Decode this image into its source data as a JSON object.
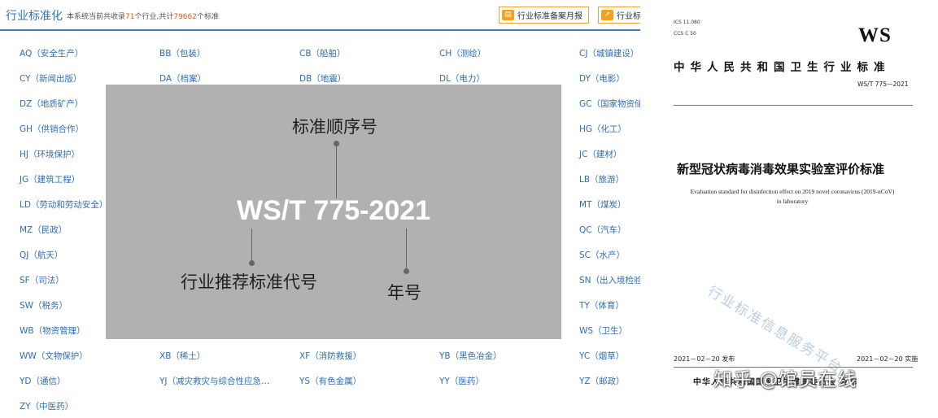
{
  "header": {
    "title": "行业标准化",
    "subtitle_prefix": "本系统当前共收录",
    "industry_count": "71",
    "subtitle_mid": "个行业,共计",
    "standard_count": "79662",
    "subtitle_suffix": "个标准",
    "btn_monthly_report": "行业标准备案月报",
    "btn_second": "行业标",
    "btn_icon": "book-icon"
  },
  "categories": [
    [
      "AQ（安全生产）",
      "BB（包装）",
      "CB（船舶）",
      "CH（测绘）",
      "CJ（城镇建设）"
    ],
    [
      "CY（新闻出版）",
      "DA（档案）",
      "DB（地震）",
      "DL（电力）",
      "DY（电影）"
    ],
    [
      "DZ（地质矿产）",
      "",
      "",
      "",
      "GC（国家物资储"
    ],
    [
      "GH（供销合作）",
      "",
      "",
      "",
      "HG（化工）"
    ],
    [
      "HJ（环境保护）",
      "",
      "",
      "",
      "JC（建材）"
    ],
    [
      "JG（建筑工程）",
      "",
      "",
      "",
      "LB（旅游）"
    ],
    [
      "LD（劳动和劳动安全）",
      "",
      "",
      "",
      "MT（煤炭）"
    ],
    [
      "MZ（民政）",
      "",
      "",
      "",
      "QC（汽车）"
    ],
    [
      "QJ（航天）",
      "",
      "",
      "",
      "SC（水产）"
    ],
    [
      "SF（司法）",
      "",
      "",
      "",
      "SN（出入境检验"
    ],
    [
      "SW（税务）",
      "",
      "",
      "",
      "TY（体育）"
    ],
    [
      "WB（物资管理）",
      "",
      "",
      "",
      "WS（卫生）"
    ],
    [
      "WW（文物保护）",
      "XB（稀土）",
      "XF（消防救援）",
      "YB（黑色冶金）",
      "YC（烟草）"
    ],
    [
      "YD（通信）",
      "YJ（减灾救灾与综合性应急…",
      "YS（有色金属）",
      "YY（医药）",
      "YZ（邮政）"
    ],
    [
      "ZY（中医药）",
      "",
      "",
      "",
      ""
    ]
  ],
  "annotation": {
    "code": "WS/T 775-2021",
    "label_sequence": "标准顺序号",
    "label_code": "行业推荐标准代号",
    "label_year": "年号"
  },
  "document": {
    "ics": "ICS 11.080",
    "ccs": "CCS C 50",
    "logo": "WS",
    "country": "中华人民共和国卫生行业标准",
    "number": "WS/T 775—2021",
    "title_cn": "新型冠状病毒消毒效果实验室评价标准",
    "title_en_1": "Evaluation standard for disinfection effect on 2019 novel coronavirus (2019-nCoV)",
    "title_en_2": "in laboratory",
    "watermark": "行业标准信息服务平台",
    "publish_date": "2021－02－20 发布",
    "implement_date": "2021－02－20 实施",
    "issuer": "中华人民共和国国家卫生健康委员会 发布"
  },
  "watermark_overlay": "知乎 @馆员在线",
  "colors": {
    "link_blue": "#2f6eb5",
    "header_rule": "#3f7fc4",
    "highlight": "#e25b1a",
    "button_border": "#f0a23a"
  }
}
